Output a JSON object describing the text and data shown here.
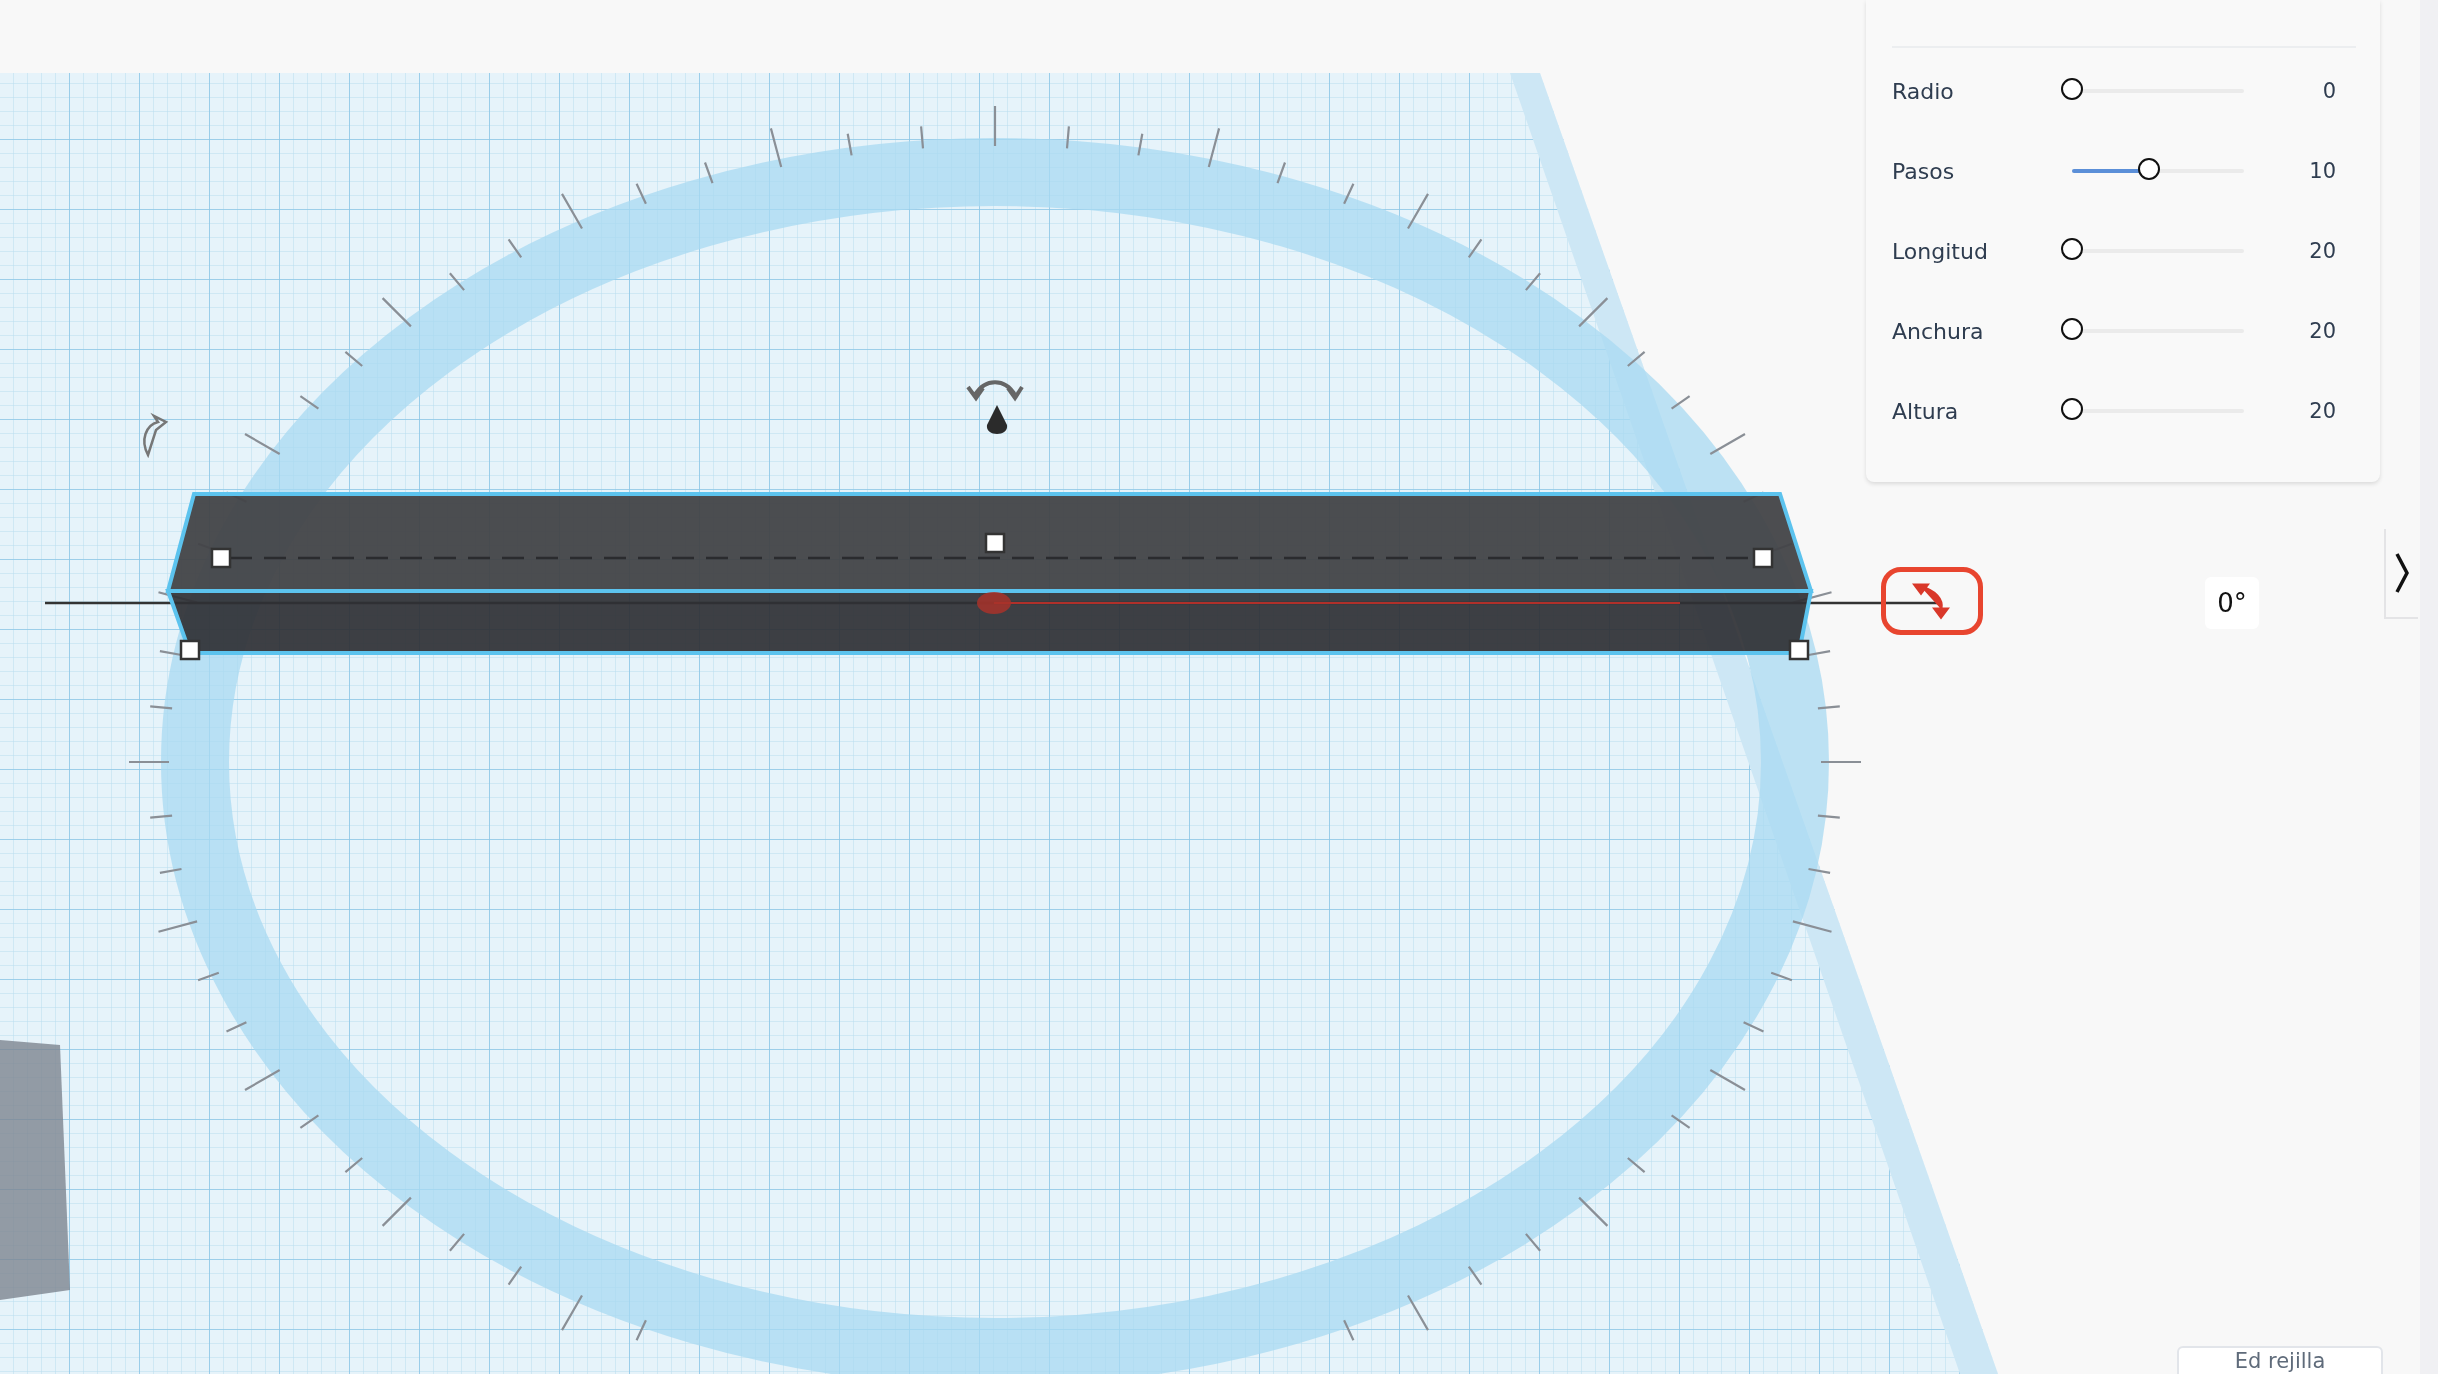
{
  "panel": {
    "parameters": [
      {
        "label": "Radio",
        "level": 0,
        "value": "0"
      },
      {
        "label": "Pasos",
        "level": 0.45,
        "value": "10"
      },
      {
        "label": "Longitud",
        "level": 0,
        "value": "20"
      },
      {
        "label": "Anchura",
        "level": 0,
        "value": "20"
      },
      {
        "label": "Altura",
        "level": 0,
        "value": "20"
      }
    ]
  },
  "rotation": {
    "angle": "0°"
  },
  "grid_button": {
    "label": "Ed rejilla"
  }
}
